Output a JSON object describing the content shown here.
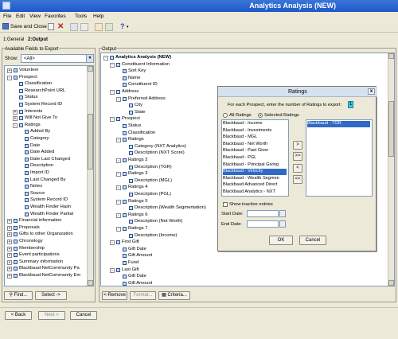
{
  "window": {
    "title": "Analytics Analysis (NEW)"
  },
  "menu": {
    "items": [
      "File",
      "Edit",
      "View",
      "Favorites",
      "Tools",
      "Help"
    ]
  },
  "toolbar": {
    "save_close": "Save and Close"
  },
  "tabs": {
    "general": "1:General",
    "output": "2:Output"
  },
  "left_panel": {
    "title": "Available Fields to Export",
    "show_label": "Show:",
    "show_value": "<All>",
    "nodes": [
      {
        "text": "Volunteer",
        "level": 0,
        "exp": "+"
      },
      {
        "text": "Prospect",
        "level": 0,
        "exp": "-"
      },
      {
        "text": "Classification",
        "level": 1
      },
      {
        "text": "ResearchPoint URL",
        "level": 1
      },
      {
        "text": "Status",
        "level": 1
      },
      {
        "text": "System Record ID",
        "level": 1
      },
      {
        "text": "Interests",
        "level": 1,
        "exp": "+"
      },
      {
        "text": "Will Not Give To",
        "level": 1,
        "exp": "+"
      },
      {
        "text": "Ratings",
        "level": 1,
        "exp": "-"
      },
      {
        "text": "Added By",
        "level": 2
      },
      {
        "text": "Category",
        "level": 2
      },
      {
        "text": "Date",
        "level": 2
      },
      {
        "text": "Date Added",
        "level": 2
      },
      {
        "text": "Date Last Changed",
        "level": 2
      },
      {
        "text": "Description",
        "level": 2
      },
      {
        "text": "Import ID",
        "level": 2
      },
      {
        "text": "Last Changed By",
        "level": 2
      },
      {
        "text": "Notes",
        "level": 2
      },
      {
        "text": "Source",
        "level": 2
      },
      {
        "text": "System Record ID",
        "level": 2
      },
      {
        "text": "Wealth Finder Hash",
        "level": 2
      },
      {
        "text": "Wealth Finder Partial",
        "level": 2
      },
      {
        "text": "Financial information",
        "level": 0,
        "exp": "+"
      },
      {
        "text": "Proposals",
        "level": 0,
        "exp": "+"
      },
      {
        "text": "Gifts to other Organization",
        "level": 0,
        "exp": "+"
      },
      {
        "text": "Chronology",
        "level": 0,
        "exp": "+"
      },
      {
        "text": "Membership",
        "level": 0,
        "exp": "+"
      },
      {
        "text": "Event participations",
        "level": 0,
        "exp": "+"
      },
      {
        "text": "Summary information",
        "level": 0,
        "exp": "+"
      },
      {
        "text": "Blackbaud NetCommunity Pa",
        "level": 0,
        "exp": "+"
      },
      {
        "text": "Blackbaud NetCommunity Em",
        "level": 0,
        "exp": "+"
      }
    ],
    "find_btn": "Find...",
    "select_btn": "Select ->"
  },
  "output_panel": {
    "title": "Output",
    "nodes": [
      {
        "text": "Analytics Analysis (NEW)",
        "level": 0,
        "exp": "-",
        "bold": true
      },
      {
        "text": "Constituent Information",
        "level": 1,
        "exp": "-"
      },
      {
        "text": "Sort Key",
        "level": 2
      },
      {
        "text": "Name",
        "level": 2
      },
      {
        "text": "Constituent ID",
        "level": 2
      },
      {
        "text": "Address",
        "level": 1,
        "exp": "-"
      },
      {
        "text": "Preferred Address",
        "level": 2,
        "exp": "-"
      },
      {
        "text": "City",
        "level": 3
      },
      {
        "text": "State",
        "level": 3
      },
      {
        "text": "Prospect",
        "level": 1,
        "exp": "-"
      },
      {
        "text": "Status",
        "level": 2
      },
      {
        "text": "Classification",
        "level": 2
      },
      {
        "text": "Ratings",
        "level": 2,
        "exp": "-"
      },
      {
        "text": "Category (NXT Analytics)",
        "level": 3
      },
      {
        "text": "Description (NXT Score)",
        "level": 3
      },
      {
        "text": "Ratings 2",
        "level": 2,
        "exp": "-"
      },
      {
        "text": "Description (TGR)",
        "level": 3
      },
      {
        "text": "Ratings 3",
        "level": 2,
        "exp": "-"
      },
      {
        "text": "Description (MGL)",
        "level": 3
      },
      {
        "text": "Ratings 4",
        "level": 2,
        "exp": "-"
      },
      {
        "text": "Description (PGL)",
        "level": 3
      },
      {
        "text": "Ratings 5",
        "level": 2,
        "exp": "-"
      },
      {
        "text": "Description (Wealth Segmentation)",
        "level": 3
      },
      {
        "text": "Ratings 6",
        "level": 2,
        "exp": "-"
      },
      {
        "text": "Description (Net Worth)",
        "level": 3
      },
      {
        "text": "Ratings 7",
        "level": 2,
        "exp": "-"
      },
      {
        "text": "Description (Income)",
        "level": 3
      },
      {
        "text": "First Gift",
        "level": 1,
        "exp": "-"
      },
      {
        "text": "Gift Date",
        "level": 2
      },
      {
        "text": "Gift Amount",
        "level": 2
      },
      {
        "text": "Fund",
        "level": 2
      },
      {
        "text": "Last Gift",
        "level": 1,
        "exp": "-"
      },
      {
        "text": "Gift Date",
        "level": 2
      },
      {
        "text": "Gift Amount",
        "level": 2
      }
    ],
    "remove_btn": "<-Remove",
    "format_btn": "Format...",
    "criteria_btn": "Criteria..."
  },
  "dialog": {
    "title": "Ratings",
    "prompt": "For each Prospect, enter the number of Ratings to export:",
    "count": "1",
    "all_ratings": "All Ratings",
    "selected_ratings": "Selected Ratings",
    "available": [
      "Blackbaud - Income",
      "Blackbaud - Investments",
      "Blackbaud - MGL",
      "Blackbaud - Net Worth",
      "Blackbaud - Past Giver",
      "Blackbaud - PGL",
      "Blackbaud - Principal Giving",
      "Blackbaud - Velocity",
      "Blackbaud - Wealth Segmen",
      "Blackbaud Advanced Direct",
      "Blackbaud Analytics - NXT"
    ],
    "selected_available_index": 7,
    "selected": [
      "Blackbaud - TGR"
    ],
    "btn_add": ">",
    "btn_add_all": ">>",
    "btn_remove": "<",
    "btn_remove_all": "<<",
    "show_inactive": "Show inactive entries",
    "start_date_label": "Start Date:",
    "end_date_label": "End Date:",
    "ok": "OK",
    "cancel": "Cancel",
    "close": "x"
  },
  "footer": {
    "back": "< Back",
    "next": "Next >",
    "cancel": "Cancel"
  }
}
